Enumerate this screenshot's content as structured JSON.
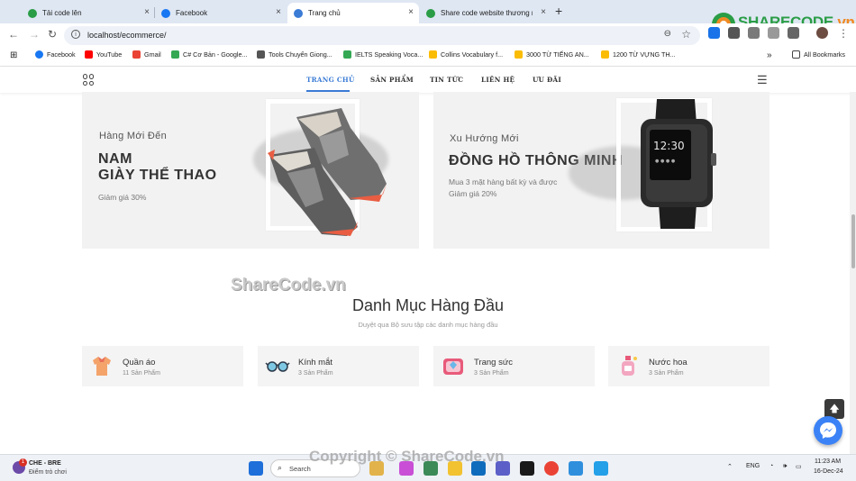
{
  "browser": {
    "tabs": [
      {
        "title": "Tải code lên",
        "color": "#2a9d46"
      },
      {
        "title": "Facebook",
        "color": "#1877f2"
      },
      {
        "title": "Trang chủ",
        "color": "#3a7bd5"
      },
      {
        "title": "Share code website thương mại",
        "color": "#2a9d46"
      }
    ],
    "tab_close": "×",
    "new_tab": "+",
    "url": "localhost/ecommerce/",
    "bookmarks": [
      {
        "label": "Facebook",
        "color": "#1877f2"
      },
      {
        "label": "YouTube",
        "color": "#ff0000"
      },
      {
        "label": "Gmail",
        "color": "#ea4335"
      },
      {
        "label": "C# Cơ Bản - Google...",
        "color": "#34a853"
      },
      {
        "label": "Tools Chuyển Giong...",
        "color": "#555555"
      },
      {
        "label": "IELTS Speaking Voca...",
        "color": "#34a853"
      },
      {
        "label": "Collins Vocabulary f...",
        "color": "#fbbc04"
      },
      {
        "label": "3000 TỪ TIẾNG AN...",
        "color": "#fbbc04"
      },
      {
        "label": "1200 TỪ VỰNG TH...",
        "color": "#fbbc04"
      }
    ],
    "all_bookmarks": "All Bookmarks",
    "logo": {
      "main": "SHARECODE",
      "suffix": ".vn"
    }
  },
  "site_nav": {
    "links": [
      "TRANG CHỦ",
      "SẢN PHẨM",
      "TIN TỨC",
      "LIÊN HỆ",
      "ƯU ĐÃI"
    ],
    "active_index": 0
  },
  "banners": [
    {
      "subtitle": "Hàng Mới Đến",
      "title_line1": "NAM",
      "title_line2": "GIÀY THỂ THAO",
      "desc_line1": "Giảm giá 30%",
      "desc_line2": ""
    },
    {
      "subtitle": "Xu Hướng Mới",
      "title_line1": "ĐỒNG HỒ THÔNG MINH",
      "title_line2": "",
      "desc_line1": "Mua 3 mặt hàng bất kỳ và được",
      "desc_line2": "Giảm giá 20%"
    }
  ],
  "watermark": "ShareCode.vn",
  "section": {
    "title": "Danh Mục Hàng Đầu",
    "subtitle": "Duyệt qua Bộ sưu tập các danh mục hàng đầu"
  },
  "categories": [
    {
      "name": "Quần áo",
      "count": "11 Sản Phẩm",
      "icon": "clothes-icon"
    },
    {
      "name": "Kính mắt",
      "count": "3 Sản Phẩm",
      "icon": "glasses-icon"
    },
    {
      "name": "Trang sức",
      "count": "3 Sản Phẩm",
      "icon": "jewelry-icon"
    },
    {
      "name": "Nước hoa",
      "count": "3 Sản Phẩm",
      "icon": "perfume-icon"
    }
  ],
  "copyright": "Copyright © ShareCode.vn",
  "taskbar": {
    "weather_title": "CHE - BRE",
    "weather_sub": "Điểm trò chơi",
    "notification_badge": "1",
    "search": "Search",
    "lang": "ENG",
    "time": "11:23 AM",
    "date": "16-Dec-24"
  }
}
